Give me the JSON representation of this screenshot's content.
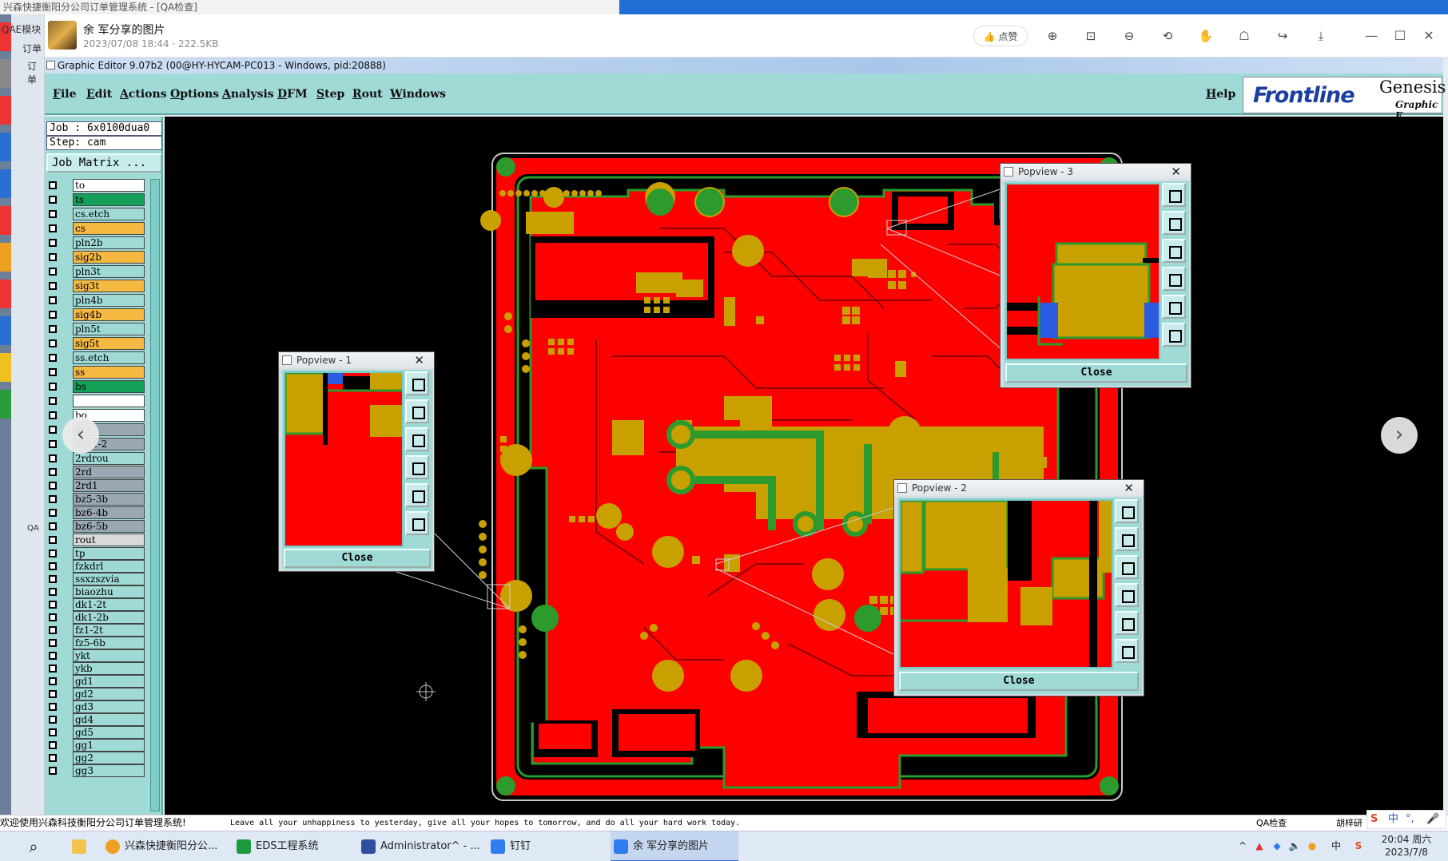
{
  "background": {
    "title": "兴森快捷衡阳分公司订单管理系统 - [QA检查]",
    "qae_module": "QAE模块",
    "tab_order": "订单",
    "tab_order2": "订单",
    "qa_label": "QA"
  },
  "viewer": {
    "title": "余  军分享的图片",
    "subtitle": "2023/07/08 18:44 · 222.5KB",
    "like_label": "点赞"
  },
  "genesis": {
    "window_title": "Graphic Editor 9.07b2 (00@HY-HYCAM-PC013 - Windows, pid:20888)",
    "menu": [
      "File",
      "Edit",
      "Actions",
      "Options",
      "Analysis",
      "DFM",
      "Step",
      "Rout",
      "Windows"
    ],
    "help": "Help",
    "brand": "Frontline",
    "brand_product": "Genesis",
    "brand_sub": "Graphic E",
    "job": "Job : 6x0100dua0",
    "step": "Step: cam",
    "job_matrix": "Job Matrix ..."
  },
  "layers": [
    {
      "name": "to",
      "color": "#ffffff"
    },
    {
      "name": "ts",
      "color": "#15a05a"
    },
    {
      "name": "cs.etch",
      "color": "#9fdad6"
    },
    {
      "name": "cs",
      "color": "#f5b942"
    },
    {
      "name": "pln2b",
      "color": "#9fdad6"
    },
    {
      "name": "sig2b",
      "color": "#f5b942"
    },
    {
      "name": "pln3t",
      "color": "#9fdad6"
    },
    {
      "name": "sig3t",
      "color": "#f5b942"
    },
    {
      "name": "pln4b",
      "color": "#9fdad6"
    },
    {
      "name": "sig4b",
      "color": "#f5b942"
    },
    {
      "name": "pln5t",
      "color": "#9fdad6"
    },
    {
      "name": "sig5t",
      "color": "#f5b942"
    },
    {
      "name": "ss.etch",
      "color": "#9fdad6"
    },
    {
      "name": "ss",
      "color": "#f5b942"
    },
    {
      "name": "bs",
      "color": "#15a05a"
    },
    {
      "name": "",
      "color": "#ffffff"
    },
    {
      "name": "bo",
      "color": "#ffffff"
    },
    {
      "name": "dr1",
      "color": "#9aa8b4"
    },
    {
      "name": "dr11-2",
      "color": "#9aa8b4"
    },
    {
      "name": "2rdrou",
      "color": "#9fdad6"
    },
    {
      "name": "2rd",
      "color": "#9aa8b4"
    },
    {
      "name": "2rd1",
      "color": "#9aa8b4"
    },
    {
      "name": "bz5-3b",
      "color": "#9aa8b4"
    },
    {
      "name": "bz6-4b",
      "color": "#9aa8b4"
    },
    {
      "name": "bz6-5b",
      "color": "#9aa8b4"
    },
    {
      "name": "rout",
      "color": "#d9d9d9"
    },
    {
      "name": "tp",
      "color": "#9fdad6"
    },
    {
      "name": "fzkdrl",
      "color": "#9fdad6"
    },
    {
      "name": "ssxzszvia",
      "color": "#9fdad6"
    },
    {
      "name": "biaozhu",
      "color": "#9fdad6"
    },
    {
      "name": "dk1-2t",
      "color": "#9fdad6"
    },
    {
      "name": "dk1-2b",
      "color": "#9fdad6"
    },
    {
      "name": "fz1-2t",
      "color": "#9fdad6"
    },
    {
      "name": "fz5-6b",
      "color": "#9fdad6"
    },
    {
      "name": "ykt",
      "color": "#9fdad6"
    },
    {
      "name": "ykb",
      "color": "#9fdad6"
    },
    {
      "name": "gd1",
      "color": "#9fdad6"
    },
    {
      "name": "gd2",
      "color": "#9fdad6"
    },
    {
      "name": "gd3",
      "color": "#9fdad6"
    },
    {
      "name": "gd4",
      "color": "#9fdad6"
    },
    {
      "name": "gd5",
      "color": "#9fdad6"
    },
    {
      "name": "gg1",
      "color": "#9fdad6"
    },
    {
      "name": "gg2",
      "color": "#9fdad6"
    },
    {
      "name": "gg3",
      "color": "#9fdad6"
    }
  ],
  "popviews": {
    "p1": {
      "title": "Popview - 1",
      "close": "Close"
    },
    "p2": {
      "title": "Popview - 2",
      "close": "Close"
    },
    "p3": {
      "title": "Popview - 3",
      "close": "Close"
    }
  },
  "status": {
    "left": "欢迎使用兴森科技衡阳分公司订单管理系统!",
    "message": "Leave all your unhappiness to yesterday, give all your hopes to tomorrow, and do all your hard work today.",
    "qa": "QA检查",
    "user": "胡梓研"
  },
  "taskbar": {
    "items": [
      "兴森快捷衡阳分公...",
      "EDS工程系统",
      "Administrator^ - ...",
      "钉钉",
      "余  军分享的图片"
    ],
    "ime": "中",
    "tray_ime": "中",
    "time": "20:04 周六",
    "date": "2023/7/8"
  },
  "colors": {
    "copper": "#ff0000",
    "pad": "#c8a000",
    "mask": "#2d9a2d",
    "panel": "#9fdad6"
  }
}
